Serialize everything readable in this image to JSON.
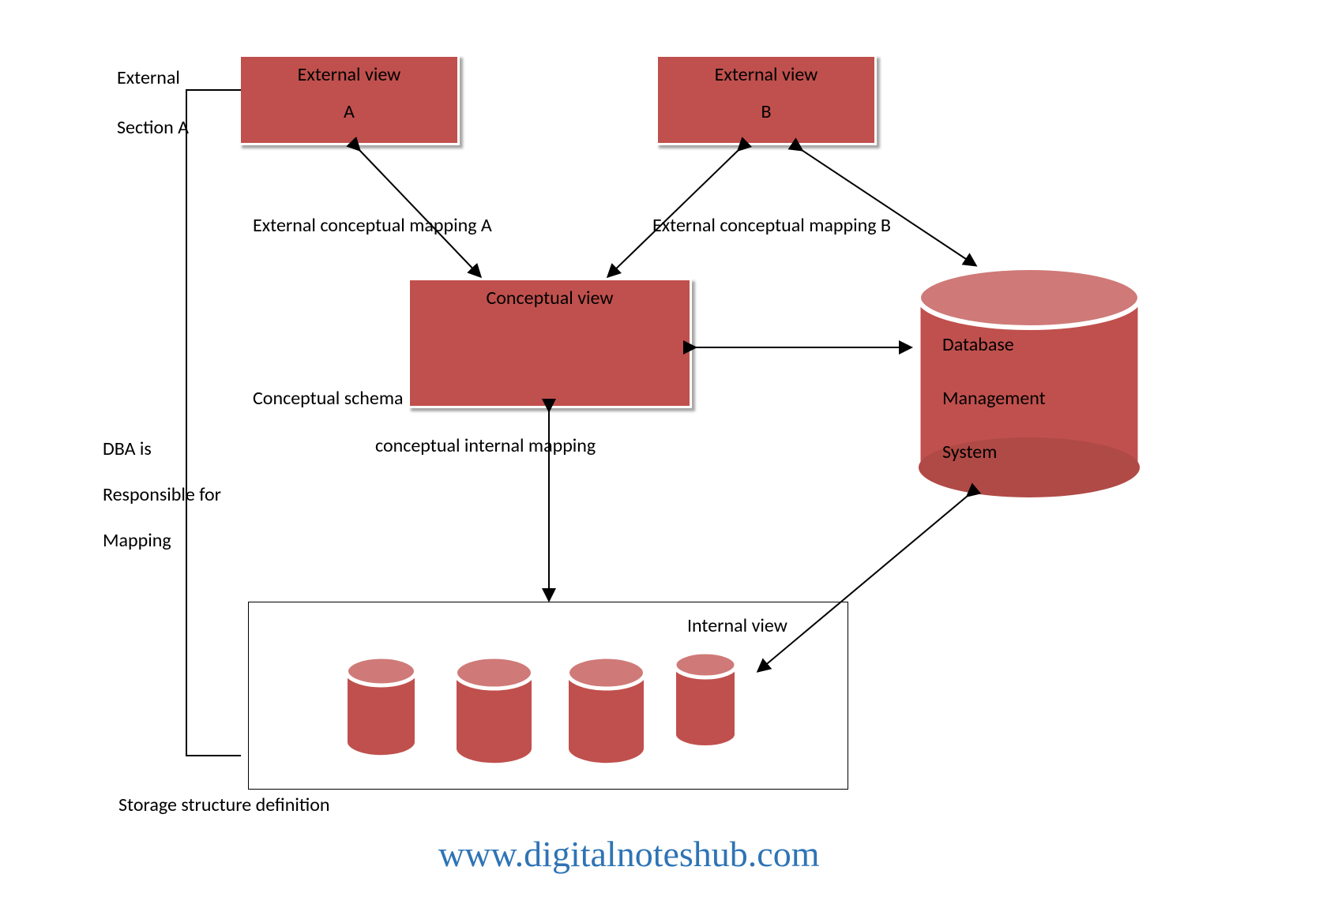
{
  "boxes": {
    "extA": {
      "line1": "External view",
      "line2": "A"
    },
    "extB": {
      "line1": "External view",
      "line2": "B"
    },
    "conceptual": {
      "line1": "Conceptual view"
    }
  },
  "labels": {
    "external": "External",
    "sectionA": "Section A",
    "mapA": "External conceptual mapping A",
    "mapB": "External conceptual mapping B",
    "conceptualSchema": "Conceptual schema",
    "conceptualInternal": "conceptual internal mapping",
    "internalView": "Internal view",
    "storageDef": "Storage structure definition",
    "dbms1": "Database",
    "dbms2": "Management",
    "dbms3": "System",
    "dba1": "DBA is",
    "dba2": "Responsible for",
    "dba3": "Mapping"
  },
  "watermark": "www.digitalnoteshub.com",
  "colors": {
    "box": "#c0504d",
    "link": "#2e74b5"
  }
}
